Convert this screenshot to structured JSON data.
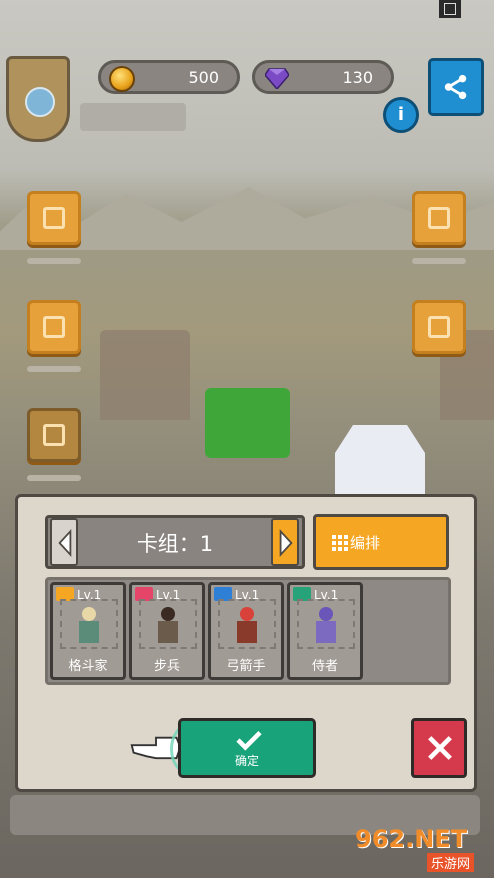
{
  "hud": {
    "gold": "500",
    "gems": "130",
    "info_symbol": "i"
  },
  "deck": {
    "title": "卡组：1",
    "edit_label": "编排"
  },
  "cards": [
    {
      "level": "Lv.1",
      "name": "格斗家",
      "badge_color": "#f5a623",
      "hair_color": "#e8d8a8",
      "cloth_color": "#5b8c7a"
    },
    {
      "level": "Lv.1",
      "name": "步兵",
      "badge_color": "#e6456a",
      "hair_color": "#3a2a22",
      "cloth_color": "#6b5b4a"
    },
    {
      "level": "Lv.1",
      "name": "弓箭手",
      "badge_color": "#2e7fd6",
      "hair_color": "#d8423a",
      "cloth_color": "#8a3a2a"
    },
    {
      "level": "Lv.1",
      "name": "侍者",
      "badge_color": "#27a37a",
      "hair_color": "#6a55b8",
      "cloth_color": "#7b6ac0"
    }
  ],
  "buttons": {
    "confirm_label": "确定",
    "close_icon": "close-icon",
    "share_icon": "share-icon"
  },
  "watermark": {
    "brand": "962.NET",
    "sub": "乐游网"
  },
  "colors": {
    "accent_orange": "#f5a623",
    "confirm_green": "#19a37a",
    "close_red": "#d53a4c",
    "share_blue": "#1f8fd1"
  }
}
